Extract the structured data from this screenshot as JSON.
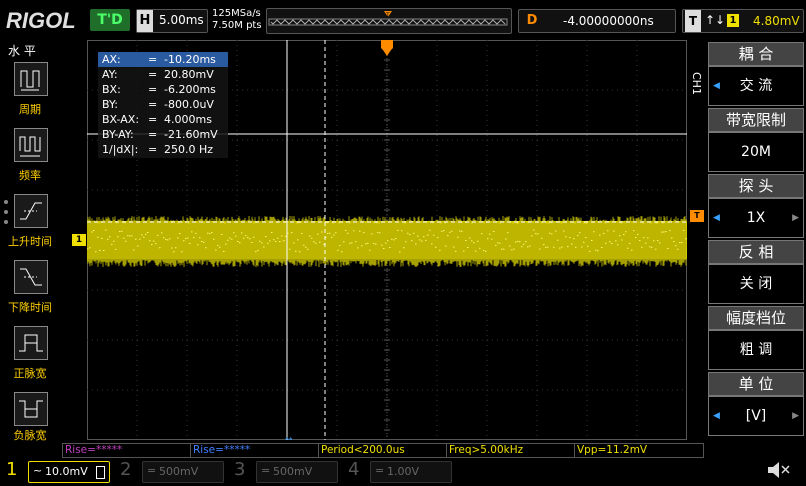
{
  "brand": "RIGOL",
  "trigger_state": "T'D",
  "horizontal": {
    "key": "H",
    "timebase": "5.00ms",
    "sample_rate": "125MSa/s",
    "mem_depth": "7.50M pts"
  },
  "delay": {
    "key": "D",
    "value": "-4.00000000ns"
  },
  "trigger": {
    "key": "T",
    "slope": "↑↓",
    "channel": "1",
    "level": "4.80mV"
  },
  "left_menu": {
    "title": "水 平",
    "items": [
      {
        "label": "周期",
        "icon": "period-icon"
      },
      {
        "label": "频率",
        "icon": "frequency-icon"
      },
      {
        "label": "上升时间",
        "icon": "rise-time-icon"
      },
      {
        "label": "下降时间",
        "icon": "fall-time-icon"
      },
      {
        "label": "正脉宽",
        "icon": "positive-width-icon"
      },
      {
        "label": "负脉宽",
        "icon": "negative-width-icon"
      }
    ]
  },
  "cursor_readout": {
    "rows": [
      {
        "label": "AX:",
        "eq": "=",
        "value": "-10.20ms"
      },
      {
        "label": "AY:",
        "eq": "=",
        "value": "20.80mV"
      },
      {
        "label": "BX:",
        "eq": "=",
        "value": "-6.200ms"
      },
      {
        "label": "BY:",
        "eq": "=",
        "value": "-800.0uV"
      },
      {
        "label": "BX-AX:",
        "eq": "=",
        "value": "4.000ms"
      },
      {
        "label": "BY-AY:",
        "eq": "=",
        "value": "-21.60mV"
      },
      {
        "label": "1/|dX|:",
        "eq": "=",
        "value": "250.0 Hz"
      }
    ]
  },
  "channel_marker": "1",
  "trigger_marker": "T",
  "right_menu": {
    "side_label": "CH1",
    "items": [
      {
        "head": "耦 合",
        "value": "交 流",
        "arrow_left": "◀",
        "arrow_right": ""
      },
      {
        "head": "带宽限制",
        "value": "20M",
        "arrow_left": "",
        "arrow_right": ""
      },
      {
        "head": "探 头",
        "value": "1X",
        "arrow_left": "◀",
        "arrow_right": "▶"
      },
      {
        "head": "反 相",
        "value": "关 闭",
        "arrow_left": "",
        "arrow_right": ""
      },
      {
        "head": "幅度档位",
        "value": "粗 调",
        "arrow_left": "",
        "arrow_right": ""
      },
      {
        "head": "单 位",
        "value": "[V]",
        "arrow_left": "◀",
        "arrow_right": "▶"
      }
    ]
  },
  "measurements": [
    {
      "text": "Rise=*****",
      "color": "#c040c0"
    },
    {
      "text": "Rise=*****",
      "color": "#4080ff"
    },
    {
      "text": "Period<200.0us",
      "color": "#f0e000"
    },
    {
      "text": "Freq>5.00kHz",
      "color": "#f0e000"
    },
    {
      "text": "Vpp=11.2mV",
      "color": "#f0e000"
    }
  ],
  "channels": [
    {
      "num": "1",
      "coupling": "~",
      "scale": "10.0mV",
      "active": true
    },
    {
      "num": "2",
      "coupling": "=",
      "scale": "500mV",
      "active": false
    },
    {
      "num": "3",
      "coupling": "=",
      "scale": "500mV",
      "active": false
    },
    {
      "num": "4",
      "coupling": "=",
      "scale": "1.00V",
      "active": false
    }
  ],
  "speaker_icon": "speaker-muted-icon",
  "colors": {
    "ch1": "#f0e000",
    "trigger": "#ff8c00",
    "accent_blue": "#3aa0ff"
  }
}
